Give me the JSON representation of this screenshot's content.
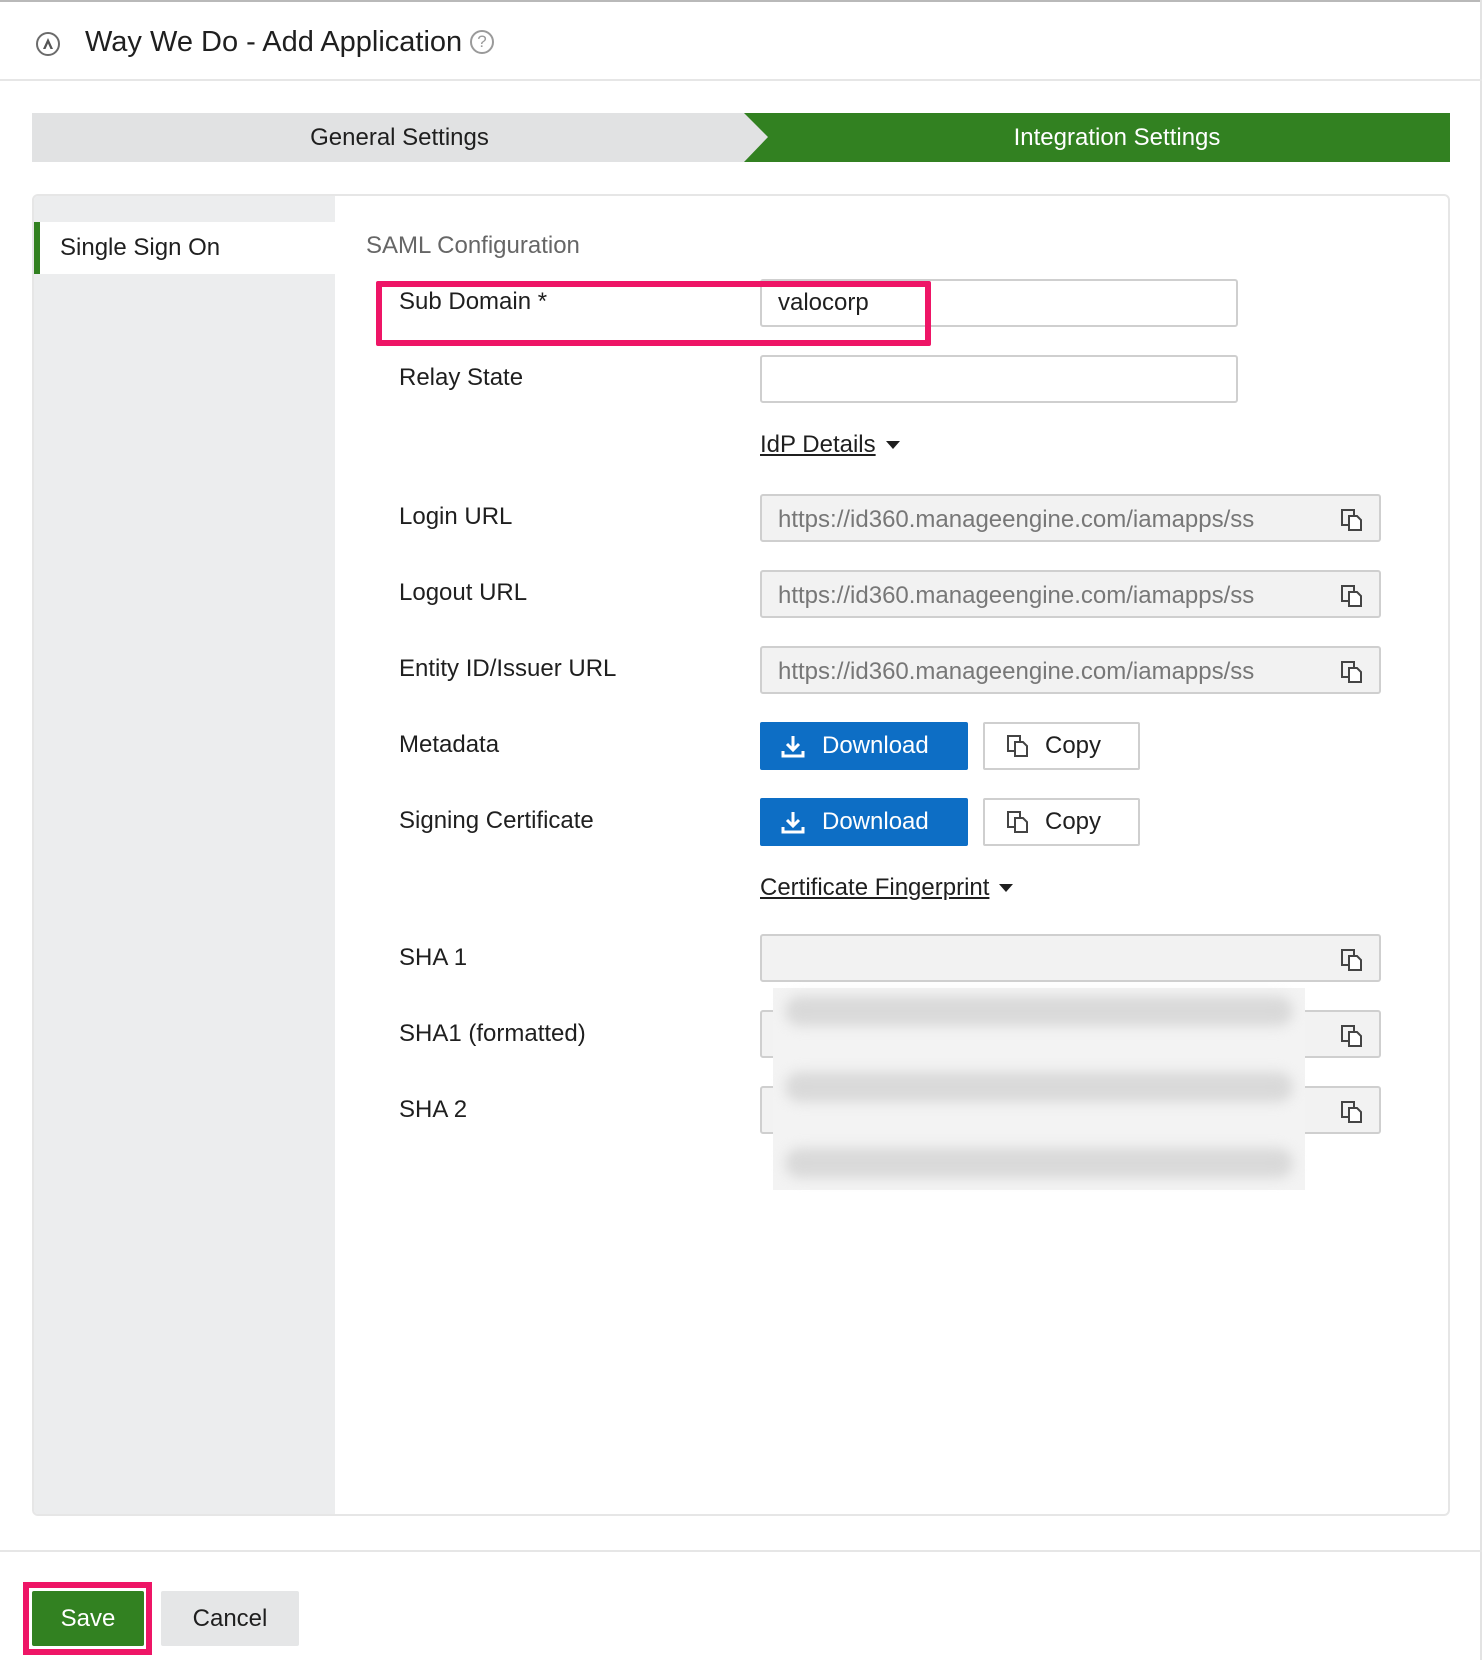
{
  "header": {
    "title": "Way We Do - Add Application",
    "logo_icon": "app-logo-icon",
    "help_icon": "help-circle-icon",
    "help_glyph": "?"
  },
  "stepper": {
    "steps": [
      {
        "label": "General Settings",
        "active": false
      },
      {
        "label": "Integration Settings",
        "active": true
      }
    ],
    "active_color": "#328121"
  },
  "sidebar": {
    "items": [
      {
        "label": "Single Sign On",
        "selected": true
      }
    ]
  },
  "saml": {
    "section_title": "SAML Configuration",
    "sub_domain": {
      "label": "Sub Domain *",
      "value": "valocorp"
    },
    "relay_state": {
      "label": "Relay State",
      "value": ""
    },
    "idp_details_label": "IdP Details",
    "login_url": {
      "label": "Login URL",
      "value": "https://id360.manageengine.com/iamapps/ss"
    },
    "logout_url": {
      "label": "Logout URL",
      "value": "https://id360.manageengine.com/iamapps/ss"
    },
    "entity_id": {
      "label": "Entity ID/Issuer URL",
      "value": "https://id360.manageengine.com/iamapps/ss"
    },
    "metadata": {
      "label": "Metadata",
      "download_label": "Download",
      "copy_label": "Copy"
    },
    "signing_certificate": {
      "label": "Signing Certificate",
      "download_label": "Download",
      "copy_label": "Copy"
    },
    "fingerprint_label": "Certificate Fingerprint",
    "sha1": {
      "label": "SHA 1"
    },
    "sha1_formatted": {
      "label": "SHA1 (formatted)"
    },
    "sha2": {
      "label": "SHA 2"
    }
  },
  "footer": {
    "save_label": "Save",
    "cancel_label": "Cancel"
  },
  "colors": {
    "primary_green": "#328121",
    "download_blue": "#0d6ec5",
    "highlight_pink": "#ee1566"
  }
}
